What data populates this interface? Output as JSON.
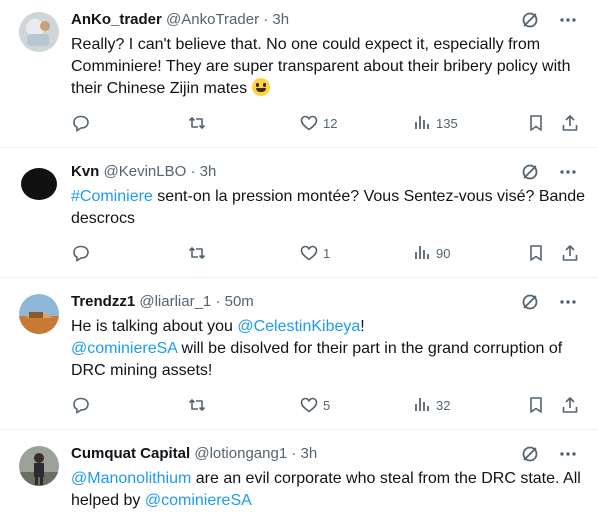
{
  "tweets": [
    {
      "name": "AnKo_trader",
      "handle": "@AnkoTrader",
      "time": "3h",
      "text_parts": [
        "Really? I can't believe that. No one could expect it, especially from Comminiere! They are super transparent about their bribery policy with their Chinese Zijin mates "
      ],
      "emoji": "grinning-face",
      "likes": "12",
      "views": "135"
    },
    {
      "name": "Kvn",
      "handle": "@KevinLBO",
      "time": "3h",
      "hashtag": "#Cominiere",
      "text_after": " sent-on la pression montée? Vous Sentez-vous visé? Bande descrocs",
      "likes": "1",
      "views": "90"
    },
    {
      "name": "Trendzz1",
      "handle": "@liarliar_1",
      "time": "50m",
      "text_before": "He is talking about you ",
      "mention1": "@CelestinKibeya",
      "text_mid": "!",
      "mention2": "@cominiereSA",
      "text_after": " will be disolved for their part in the grand corruption of DRC mining assets!",
      "likes": "5",
      "views": "32"
    },
    {
      "name": "Cumquat Capital",
      "handle": "@lotiongang1",
      "time": "3h",
      "mention1": "@Manonolithium",
      "text_mid": " are an evil corporate who steal from the DRC state. All helped by ",
      "mention2": "@cominiereSA"
    }
  ],
  "separator": "·",
  "colors": {
    "text": "#0f1419",
    "muted": "#536471",
    "link": "#1d9bf0",
    "border": "#eff3f4"
  },
  "icons": [
    "reply-icon",
    "retweet-icon",
    "like-icon",
    "views-icon",
    "bookmark-icon",
    "share-icon",
    "grok-icon",
    "more-icon"
  ]
}
